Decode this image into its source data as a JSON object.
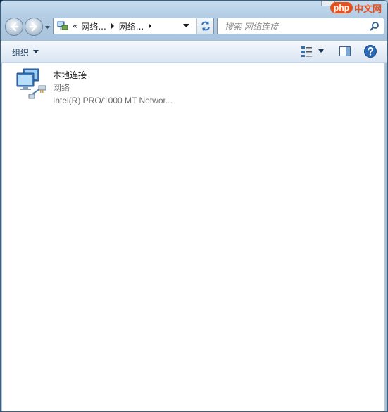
{
  "address": {
    "overflow": "«",
    "crumbs": [
      "网络...",
      "网络..."
    ]
  },
  "search": {
    "placeholder": "搜索 网络连接"
  },
  "watermark": {
    "badge": "php",
    "text": "中文网"
  },
  "toolbar": {
    "organize_label": "组织"
  },
  "items": [
    {
      "name": "本地连接",
      "network": "网络",
      "device": "Intel(R) PRO/1000 MT Networ..."
    }
  ],
  "icons": {
    "back": "back-arrow-icon",
    "forward": "forward-arrow-icon",
    "refresh": "refresh-icon",
    "search": "search-icon",
    "view": "view-options-icon",
    "preview": "preview-pane-icon",
    "help": "help-icon",
    "network_adapter": "network-adapter-icon"
  },
  "colors": {
    "accent": "#1e395b",
    "watermark": "#e6501d"
  }
}
